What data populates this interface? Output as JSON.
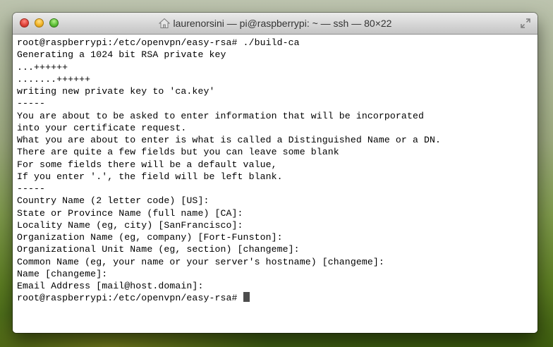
{
  "window": {
    "title": "laurenorsini — pi@raspberrypi: ~ — ssh — 80×22",
    "controls": {
      "close": "close-button",
      "minimize": "minimize-button",
      "zoom": "zoom-button"
    },
    "icons": {
      "title": "home-folder-icon",
      "resize": "fullscreen-icon"
    }
  },
  "colors": {
    "close": "#e0443a",
    "minimize": "#f2b529",
    "zoom": "#5fc13a",
    "terminal_background": "#ffffff",
    "terminal_text": "#000000",
    "cursor": "#4d4d4d"
  },
  "terminal": {
    "lines": [
      "root@raspberrypi:/etc/openvpn/easy-rsa# ./build-ca",
      "Generating a 1024 bit RSA private key",
      "...++++++",
      ".......++++++",
      "writing new private key to 'ca.key'",
      "-----",
      "You are about to be asked to enter information that will be incorporated",
      "into your certificate request.",
      "What you are about to enter is what is called a Distinguished Name or a DN.",
      "There are quite a few fields but you can leave some blank",
      "For some fields there will be a default value,",
      "If you enter '.', the field will be left blank.",
      "-----",
      "Country Name (2 letter code) [US]:",
      "State or Province Name (full name) [CA]:",
      "Locality Name (eg, city) [SanFrancisco]:",
      "Organization Name (eg, company) [Fort-Funston]:",
      "Organizational Unit Name (eg, section) [changeme]:",
      "Common Name (eg, your name or your server's hostname) [changeme]:",
      "Name [changeme]:",
      "Email Address [mail@host.domain]:"
    ],
    "prompt": "root@raspberrypi:/etc/openvpn/easy-rsa# "
  }
}
